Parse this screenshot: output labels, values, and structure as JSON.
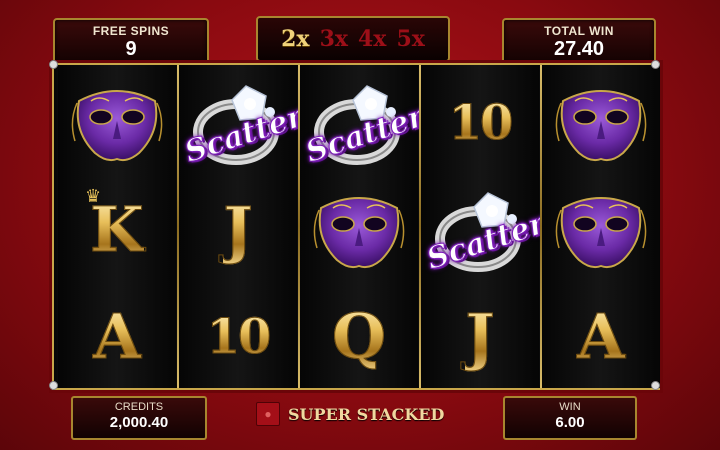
{
  "free_spins": {
    "label": "FREE SPINS",
    "value": "9"
  },
  "multipliers": [
    {
      "label": "2x",
      "active": true
    },
    {
      "label": "3x",
      "active": false
    },
    {
      "label": "4x",
      "active": false
    },
    {
      "label": "5x",
      "active": false
    }
  ],
  "total_win": {
    "label": "TOTAL WIN",
    "value": "27.40"
  },
  "reels": [
    [
      "purple-mask",
      "king",
      "ace"
    ],
    [
      "scatter-ring",
      "jack",
      "ten"
    ],
    [
      "scatter-ring",
      "purple-mask",
      "queen"
    ],
    [
      "ten",
      "scatter-ring",
      "jack"
    ],
    [
      "purple-mask",
      "purple-mask",
      "ace"
    ]
  ],
  "symbol_text": {
    "scatter": "Scatter",
    "king": "K",
    "ace": "A",
    "jack": "J",
    "ten": "10",
    "queen": "Q"
  },
  "credits": {
    "label": "CREDITS",
    "value": "2,000.40"
  },
  "feature_label": "SUPER STACKED",
  "win": {
    "label": "WIN",
    "value": "6.00"
  },
  "colors": {
    "accent_gold": "#c9a74a",
    "background_red": "#b3141b",
    "mask_purple": "#6a2aa6"
  }
}
